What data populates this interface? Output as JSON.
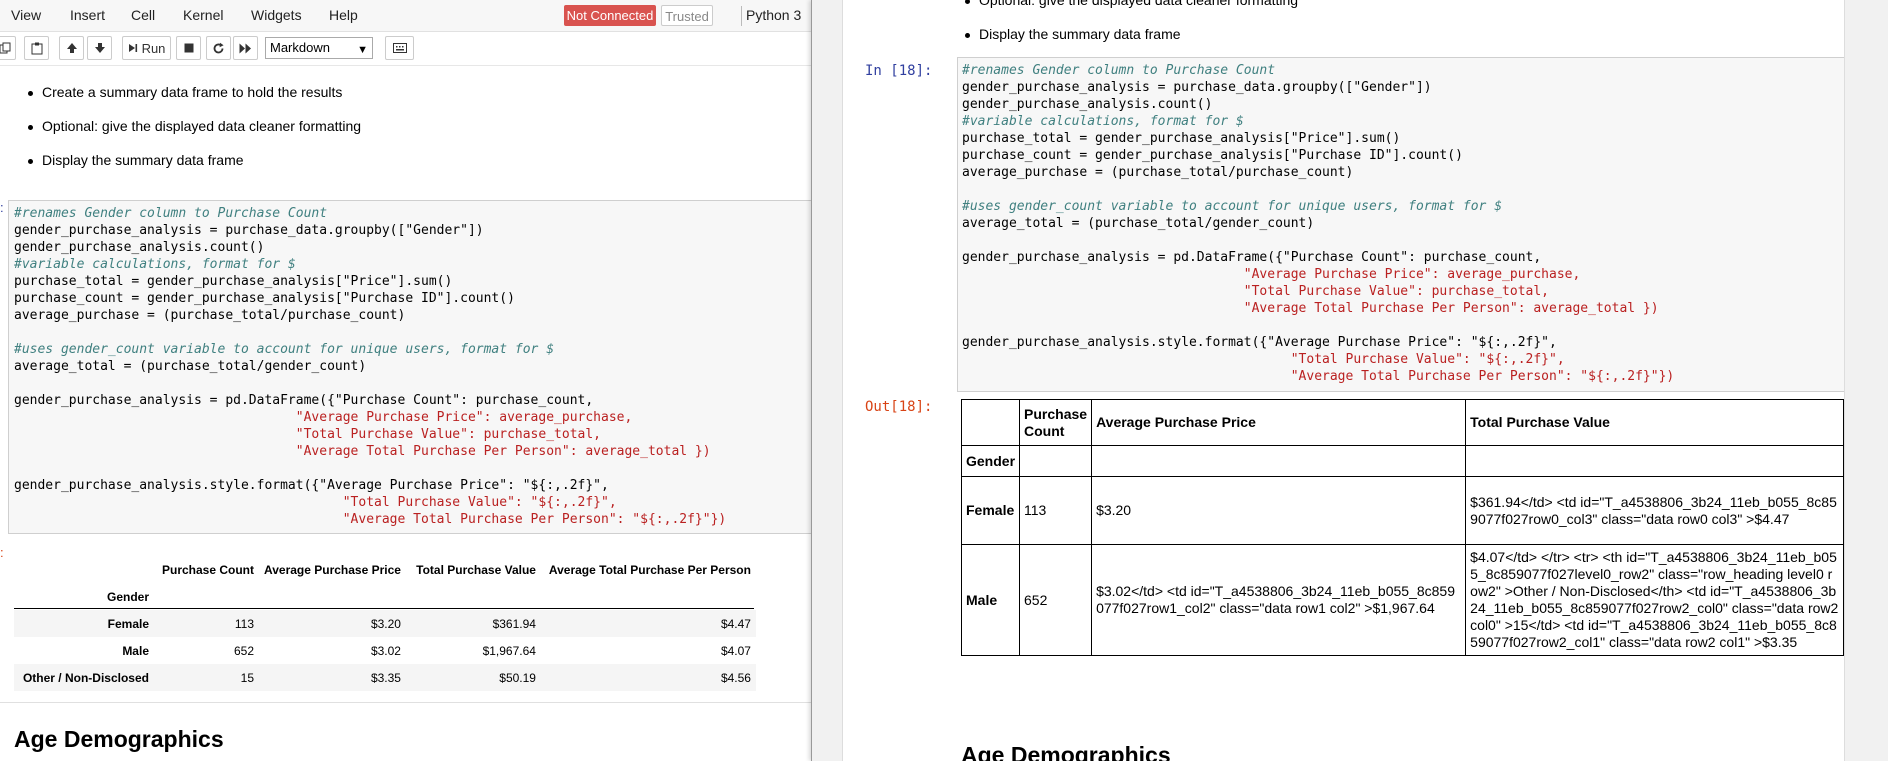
{
  "menu": [
    "View",
    "Insert",
    "Cell",
    "Kernel",
    "Widgets",
    "Help"
  ],
  "status": {
    "connection": "Not Connected",
    "trust": "Trusted",
    "kernel": "Python 3"
  },
  "toolbar": {
    "run_label": "Run",
    "cell_type": "Markdown"
  },
  "bullets": [
    "Create a summary data frame to hold the results",
    "Optional: give the displayed data cleaner formatting",
    "Display the summary data frame"
  ],
  "right_top": {
    "bullet_cut": "Optional: give the displayed data cleaner formatting",
    "bullet": "Display the summary data frame"
  },
  "cell": {
    "in_prompt": "In [18]:",
    "out_prompt": "Out[18]:",
    "code": [
      "#renames Gender column to Purchase Count",
      "gender_purchase_analysis = purchase_data.groupby([\"Gender\"])",
      "gender_purchase_analysis.count()",
      "#variable calculations, format for $",
      "purchase_total = gender_purchase_analysis[\"Price\"].sum()",
      "purchase_count = gender_purchase_analysis[\"Purchase ID\"].count()",
      "average_purchase = (purchase_total/purchase_count)",
      "",
      "#uses gender_count variable to account for unique users, format for $",
      "average_total = (purchase_total/gender_count)",
      "",
      "gender_purchase_analysis = pd.DataFrame({\"Purchase Count\": purchase_count,",
      "                                    \"Average Purchase Price\": average_purchase,",
      "                                    \"Total Purchase Value\": purchase_total,",
      "                                    \"Average Total Purchase Per Person\": average_total })",
      "",
      "gender_purchase_analysis.style.format({\"Average Purchase Price\": \"${:,.2f}\",",
      "                                          \"Total Purchase Value\": \"${:,.2f}\",",
      "                                          \"Average Total Purchase Per Person\": \"${:,.2f}\"})"
    ]
  },
  "left_table": {
    "columns": [
      "Purchase Count",
      "Average Purchase Price",
      "Total Purchase Value",
      "Average Total Purchase Per Person"
    ],
    "index_name": "Gender",
    "rows": [
      {
        "label": "Female",
        "values": [
          "113",
          "$3.20",
          "$361.94",
          "$4.47"
        ]
      },
      {
        "label": "Male",
        "values": [
          "652",
          "$3.02",
          "$1,967.64",
          "$4.07"
        ]
      },
      {
        "label": "Other / Non-Disclosed",
        "values": [
          "15",
          "$3.35",
          "$50.19",
          "$4.56"
        ]
      }
    ]
  },
  "right_table": {
    "col1": "Purchase Count",
    "col2": "Average Purchase Price",
    "col3": "Total Purchase Value",
    "index_name": "Gender",
    "female": {
      "label": "Female",
      "count": "113",
      "avg": "$3.20",
      "total": "$361.94</td> <td id=\"T_a4538806_3b24_11eb_b055_8c859077f027row0_col3\" class=\"data row0 col3\" >$4.47"
    },
    "male": {
      "label": "Male",
      "count": "652",
      "avg": "$3.02</td> <td id=\"T_a4538806_3b24_11eb_b055_8c859077f027row1_col2\" class=\"data row1 col2\" >$1,967.64",
      "total": "$4.07</td> </tr> <tr> <th id=\"T_a4538806_3b24_11eb_b055_8c859077f027level0_row2\" class=\"row_heading level0 row2\" >Other / Non-Disclosed</th> <td id=\"T_a4538806_3b24_11eb_b055_8c859077f027row2_col0\" class=\"data row2 col0\" >15</td> <td id=\"T_a4538806_3b24_11eb_b055_8c859077f027row2_col1\" class=\"data row2 col1\" >$3.35"
    }
  },
  "next_heading": "Age Demographics"
}
